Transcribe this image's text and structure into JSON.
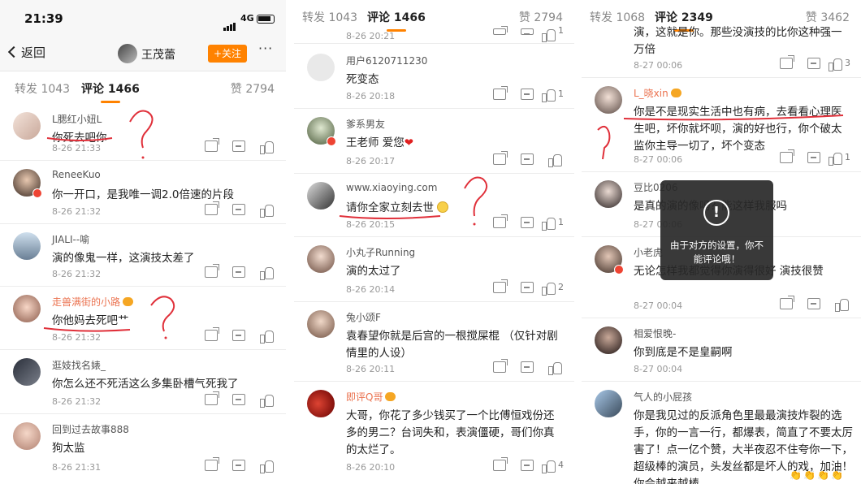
{
  "colors": {
    "accent": "#ff8200",
    "ink_red": "#e0303a",
    "username_orange": "#eb7350"
  },
  "status_bar": {
    "time": "21:39",
    "network": "4G"
  },
  "nav": {
    "back_label": "返回",
    "profile_name": "王茂蕾",
    "follow_label": "+关注",
    "more_label": "···"
  },
  "toast": {
    "icon": "!",
    "message": "由于对方的设置，你不能评论哦！"
  },
  "panels": [
    {
      "tabs": {
        "repost": "转发 1043",
        "comments": "评论 1466",
        "likes": "赞 2794"
      },
      "comments": [
        {
          "user": "L腮红小妞L",
          "text": "你死去吧你",
          "time": "8-26 21:33",
          "likes": ""
        },
        {
          "user": "ReneeKuo",
          "text": "你一开口，是我唯一调2.0倍速的片段",
          "time": "8-26 21:32",
          "likes": ""
        },
        {
          "user": "JIALI--喻",
          "text": "演的像鬼一样，这演技太差了",
          "time": "8-26 21:32",
          "likes": ""
        },
        {
          "user": "走兽满街的小路",
          "text": "你他妈去死吧艹",
          "time": "8-26 21:32",
          "likes": ""
        },
        {
          "user": "逛妓找名婊_",
          "text": "你怎么还不死活这么多集卧槽气死我了",
          "time": "8-26 21:32",
          "likes": ""
        },
        {
          "user": "回到过去故事888",
          "text": "狗太监",
          "time": "8-26 21:31",
          "likes": ""
        }
      ]
    },
    {
      "tabs": {
        "repost": "转发 1043",
        "comments": "评论 1466",
        "likes": "赞 2794"
      },
      "top_time": "8-26 20:21",
      "top_likes": "1",
      "comments": [
        {
          "user": "用户6120711230",
          "text": "死变态",
          "time": "8-26 20:18",
          "likes": "1"
        },
        {
          "user": "爹系男友",
          "text": "王老师 爱您",
          "heart": "❤",
          "time": "8-26 20:17",
          "likes": ""
        },
        {
          "user": "www.xiaoying.com",
          "text": "请你全家立刻去世",
          "time": "8-26 20:15",
          "likes": "1"
        },
        {
          "user": "小丸子Running",
          "text": "演的太过了",
          "time": "8-26 20:14",
          "likes": "2"
        },
        {
          "user": "兔小颂F",
          "text": "袁春望你就是后宫的一根搅屎棍  （仅针对剧情里的人设）",
          "time": "8-26 20:11",
          "likes": ""
        },
        {
          "user": "即评Q哥",
          "text": "大哥，你花了多少钱买了一个比傅恒戏份还多的男二？台词失和，表演僵硬，哥们你真的太烂了。",
          "time": "8-26 20:10",
          "likes": "4"
        }
      ]
    },
    {
      "tabs": {
        "repost": "转发 1068",
        "comments": "评论 2349",
        "likes": "赞 3462"
      },
      "comments": [
        {
          "user": "",
          "text": "演，这就是你。那些没演技的比你这种强一万倍",
          "time": "8-27 00:06",
          "likes": "3"
        },
        {
          "user": "L_晓xin",
          "text": "你是不是现实生活中也有病，去看看心理医生吧，坏你就坏呗，演的好也行，你个破太监你主导一切了，坏个变态",
          "time": "8-27 00:06",
          "likes": "1"
        },
        {
          "user": "豆比0206",
          "text": "是真的演的像吗？能这样我服吗",
          "time": "8-27 00:06",
          "likes": ""
        },
        {
          "user": "小老虎",
          "text": "无论怎样我都觉得你演得很好 演技很赞",
          "time": "8-27 00:04",
          "likes": ""
        },
        {
          "user": "相爱恨晚-",
          "text": "你到底是不是皇嗣啊",
          "time": "8-27 00:04",
          "likes": ""
        },
        {
          "user": "气人的小屁孩",
          "text": "你是我见过的反派角色里最最演技炸裂的选手，你的一言一行，都爆表，简直了不要太厉害了！点一亿个赞，大半夜忍不住夸你一下，超级棒的演员，头发丝都是坏人的戏，加油！你会越来越棒",
          "time": "",
          "likes": ""
        }
      ]
    }
  ]
}
